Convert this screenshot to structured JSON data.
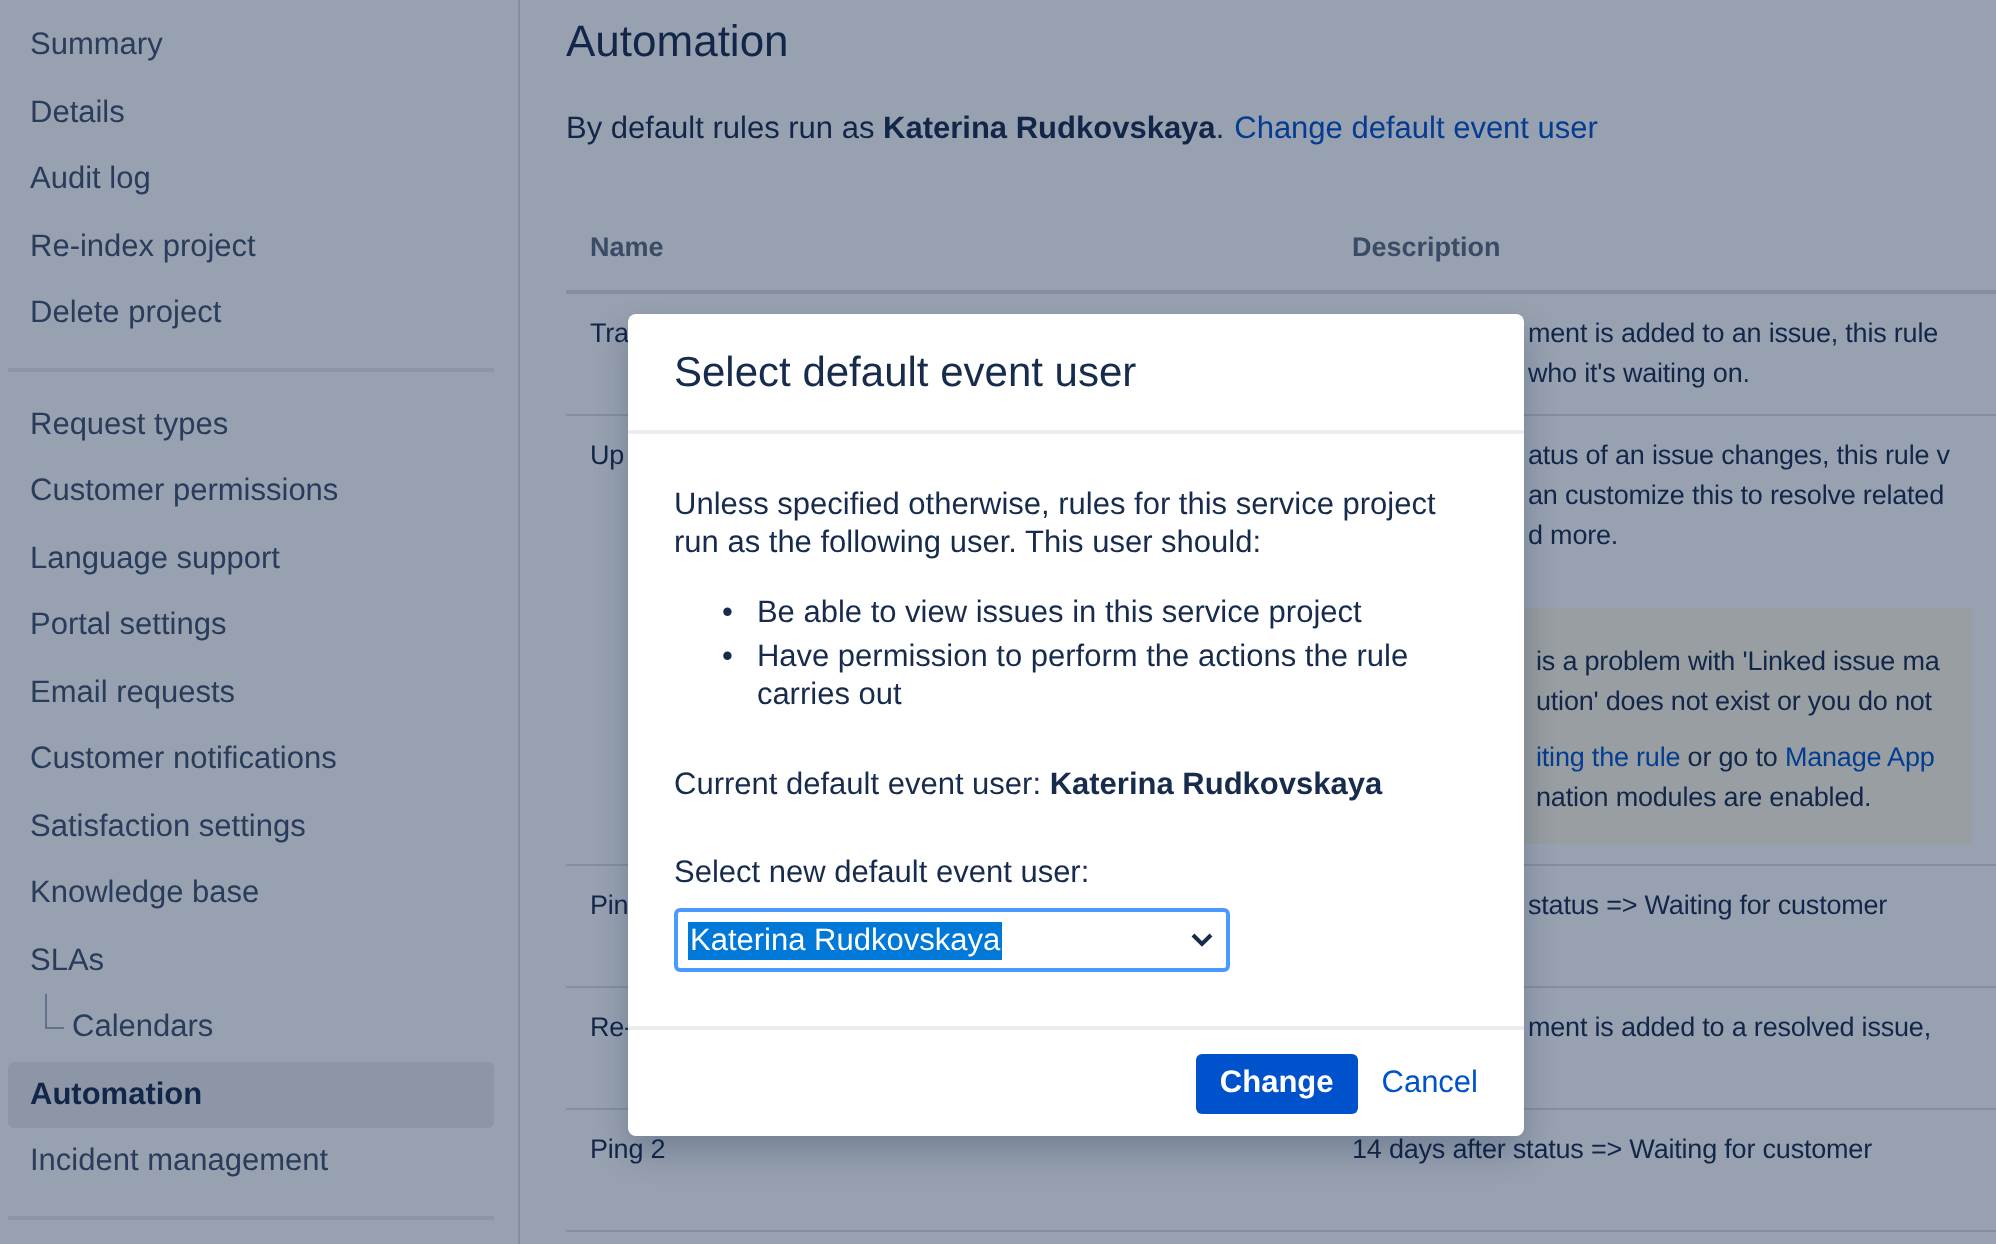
{
  "sidebar": {
    "groups": [
      [
        {
          "label": "Summary",
          "selected": false
        },
        {
          "label": "Details",
          "selected": false
        },
        {
          "label": "Audit log",
          "selected": false
        },
        {
          "label": "Re-index project",
          "selected": false
        },
        {
          "label": "Delete project",
          "selected": false
        }
      ],
      [
        {
          "label": "Request types",
          "selected": false
        },
        {
          "label": "Customer permissions",
          "selected": false
        },
        {
          "label": "Language support",
          "selected": false
        },
        {
          "label": "Portal settings",
          "selected": false
        },
        {
          "label": "Email requests",
          "selected": false
        },
        {
          "label": "Customer notifications",
          "selected": false
        },
        {
          "label": "Satisfaction settings",
          "selected": false
        },
        {
          "label": "Knowledge base",
          "selected": false
        },
        {
          "label": "SLAs",
          "selected": false,
          "children": [
            {
              "label": "Calendars",
              "selected": false
            }
          ]
        },
        {
          "label": "Automation",
          "selected": true
        },
        {
          "label": "Incident management",
          "selected": false
        }
      ]
    ]
  },
  "page": {
    "title": "Automation",
    "intro": "By default rules run as **Katerina Rudkovskaya**.",
    "intro_link": "Change default event user"
  },
  "table": {
    "columns": [
      "Name",
      "Description"
    ],
    "rows": [
      {
        "kind": "covered",
        "name": "Tra",
        "description": [
          "ment is added to an issue, this rule",
          "who it's waiting on."
        ]
      },
      {
        "kind": "covered",
        "name": "Up",
        "description": [
          "atus of an issue changes, this rule v",
          "an customize this to resolve related",
          "d more."
        ],
        "notice": [
          [
            {
              "text": "is a problem with 'Linked issue ma",
              "link": false
            }
          ],
          [
            {
              "text": "ution' does not exist or you do not",
              "link": false
            }
          ],
          [
            {
              "text": "iting the rule",
              "link": true
            },
            {
              "text": " or go to ",
              "link": false
            },
            {
              "text": "Manage App",
              "link": true
            }
          ],
          [
            {
              "text": "nation modules are enabled.",
              "link": false
            }
          ]
        ]
      },
      {
        "kind": "covered",
        "name": "Pin",
        "description": [
          "status => Waiting for customer"
        ]
      },
      {
        "kind": "covered",
        "name": "Re-",
        "description": [
          "ment is added to a resolved issue,"
        ]
      },
      {
        "kind": "full",
        "name": "Ping 2",
        "description": [
          "14 days after status => Waiting for customer"
        ]
      }
    ]
  },
  "dialog": {
    "title": "Select default event user",
    "text": "Unless specified otherwise, rules for this service project run as the following user. This user should:",
    "bullets": [
      {
        "marker": "•",
        "text": "Be able to view issues in this service project"
      },
      {
        "marker": "•",
        "text": "Have permission to perform the actions the rule carries out"
      }
    ],
    "current": "Current default event user: **Katerina Rudkovskaya**",
    "select_label": "Select new default event user:",
    "select": {
      "value": "Katerina Rudkovskaya",
      "selected": true
    },
    "buttons": [
      {
        "label": "Change",
        "kind": "primary"
      },
      {
        "label": "Cancel",
        "kind": "link"
      }
    ]
  }
}
